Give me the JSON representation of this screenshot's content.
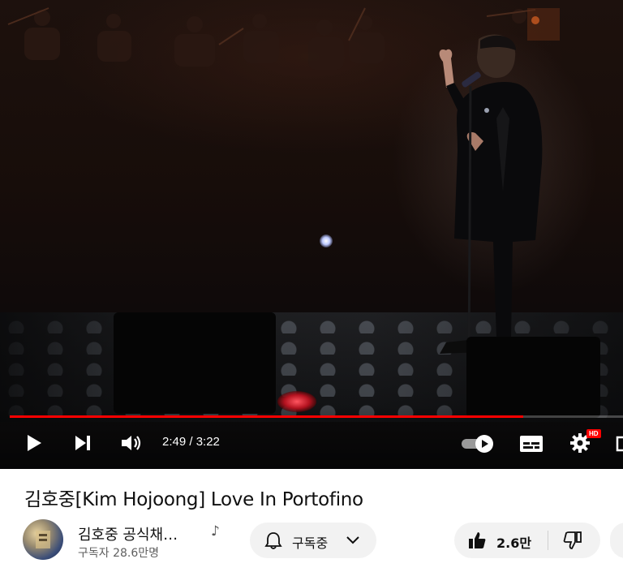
{
  "player": {
    "current_time": "2:49",
    "duration": "3:22",
    "time_display": "2:49 / 3:22",
    "progress": 0.837,
    "hd_badge": "HD",
    "icons": [
      "play-icon",
      "next-icon",
      "volume-icon",
      "autoplay-toggle",
      "subtitles-icon",
      "settings-icon",
      "fullscreen-icon"
    ],
    "accent": "#ff0000"
  },
  "video": {
    "title": "김호중[Kim Hojoong] Love In Portofino"
  },
  "channel": {
    "name": "김호중 공식채…",
    "subscribers": "구독자 28.6만명",
    "music_icon": "music-note-icon"
  },
  "actions": {
    "subscribe_label": "구독중",
    "like_count": "2.6만"
  }
}
